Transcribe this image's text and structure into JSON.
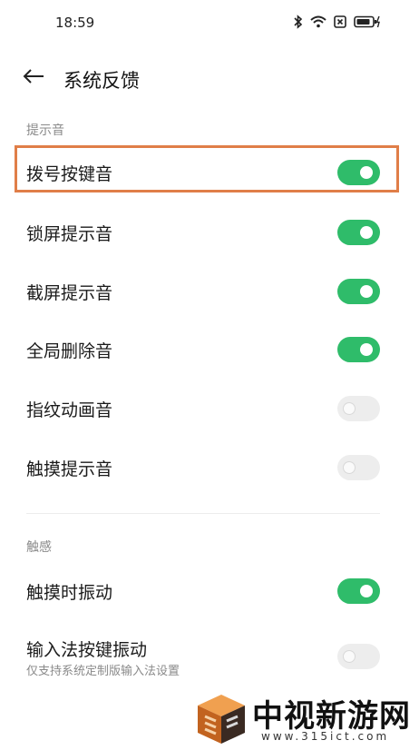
{
  "status_bar": {
    "time": "18:59"
  },
  "header": {
    "title": "系统反馈"
  },
  "sections": {
    "sounds": {
      "label": "提示音"
    },
    "haptics": {
      "label": "触感"
    }
  },
  "settings": [
    {
      "label": "拨号按键音",
      "enabled": true
    },
    {
      "label": "锁屏提示音",
      "enabled": true
    },
    {
      "label": "截屏提示音",
      "enabled": true
    },
    {
      "label": "全局删除音",
      "enabled": true
    },
    {
      "label": "指纹动画音",
      "enabled": false
    },
    {
      "label": "触摸提示音",
      "enabled": false
    },
    {
      "label": "触摸时振动",
      "enabled": true
    },
    {
      "label": "输入法按键振动",
      "sublabel": "仅支持系统定制版输入法设置",
      "enabled": false
    }
  ],
  "watermark": {
    "title": "中视新游网",
    "url": "www.315ict.com"
  },
  "colors": {
    "toggle_on": "#2fbc6a",
    "toggle_off": "#ededed",
    "highlight": "#e07e48"
  }
}
